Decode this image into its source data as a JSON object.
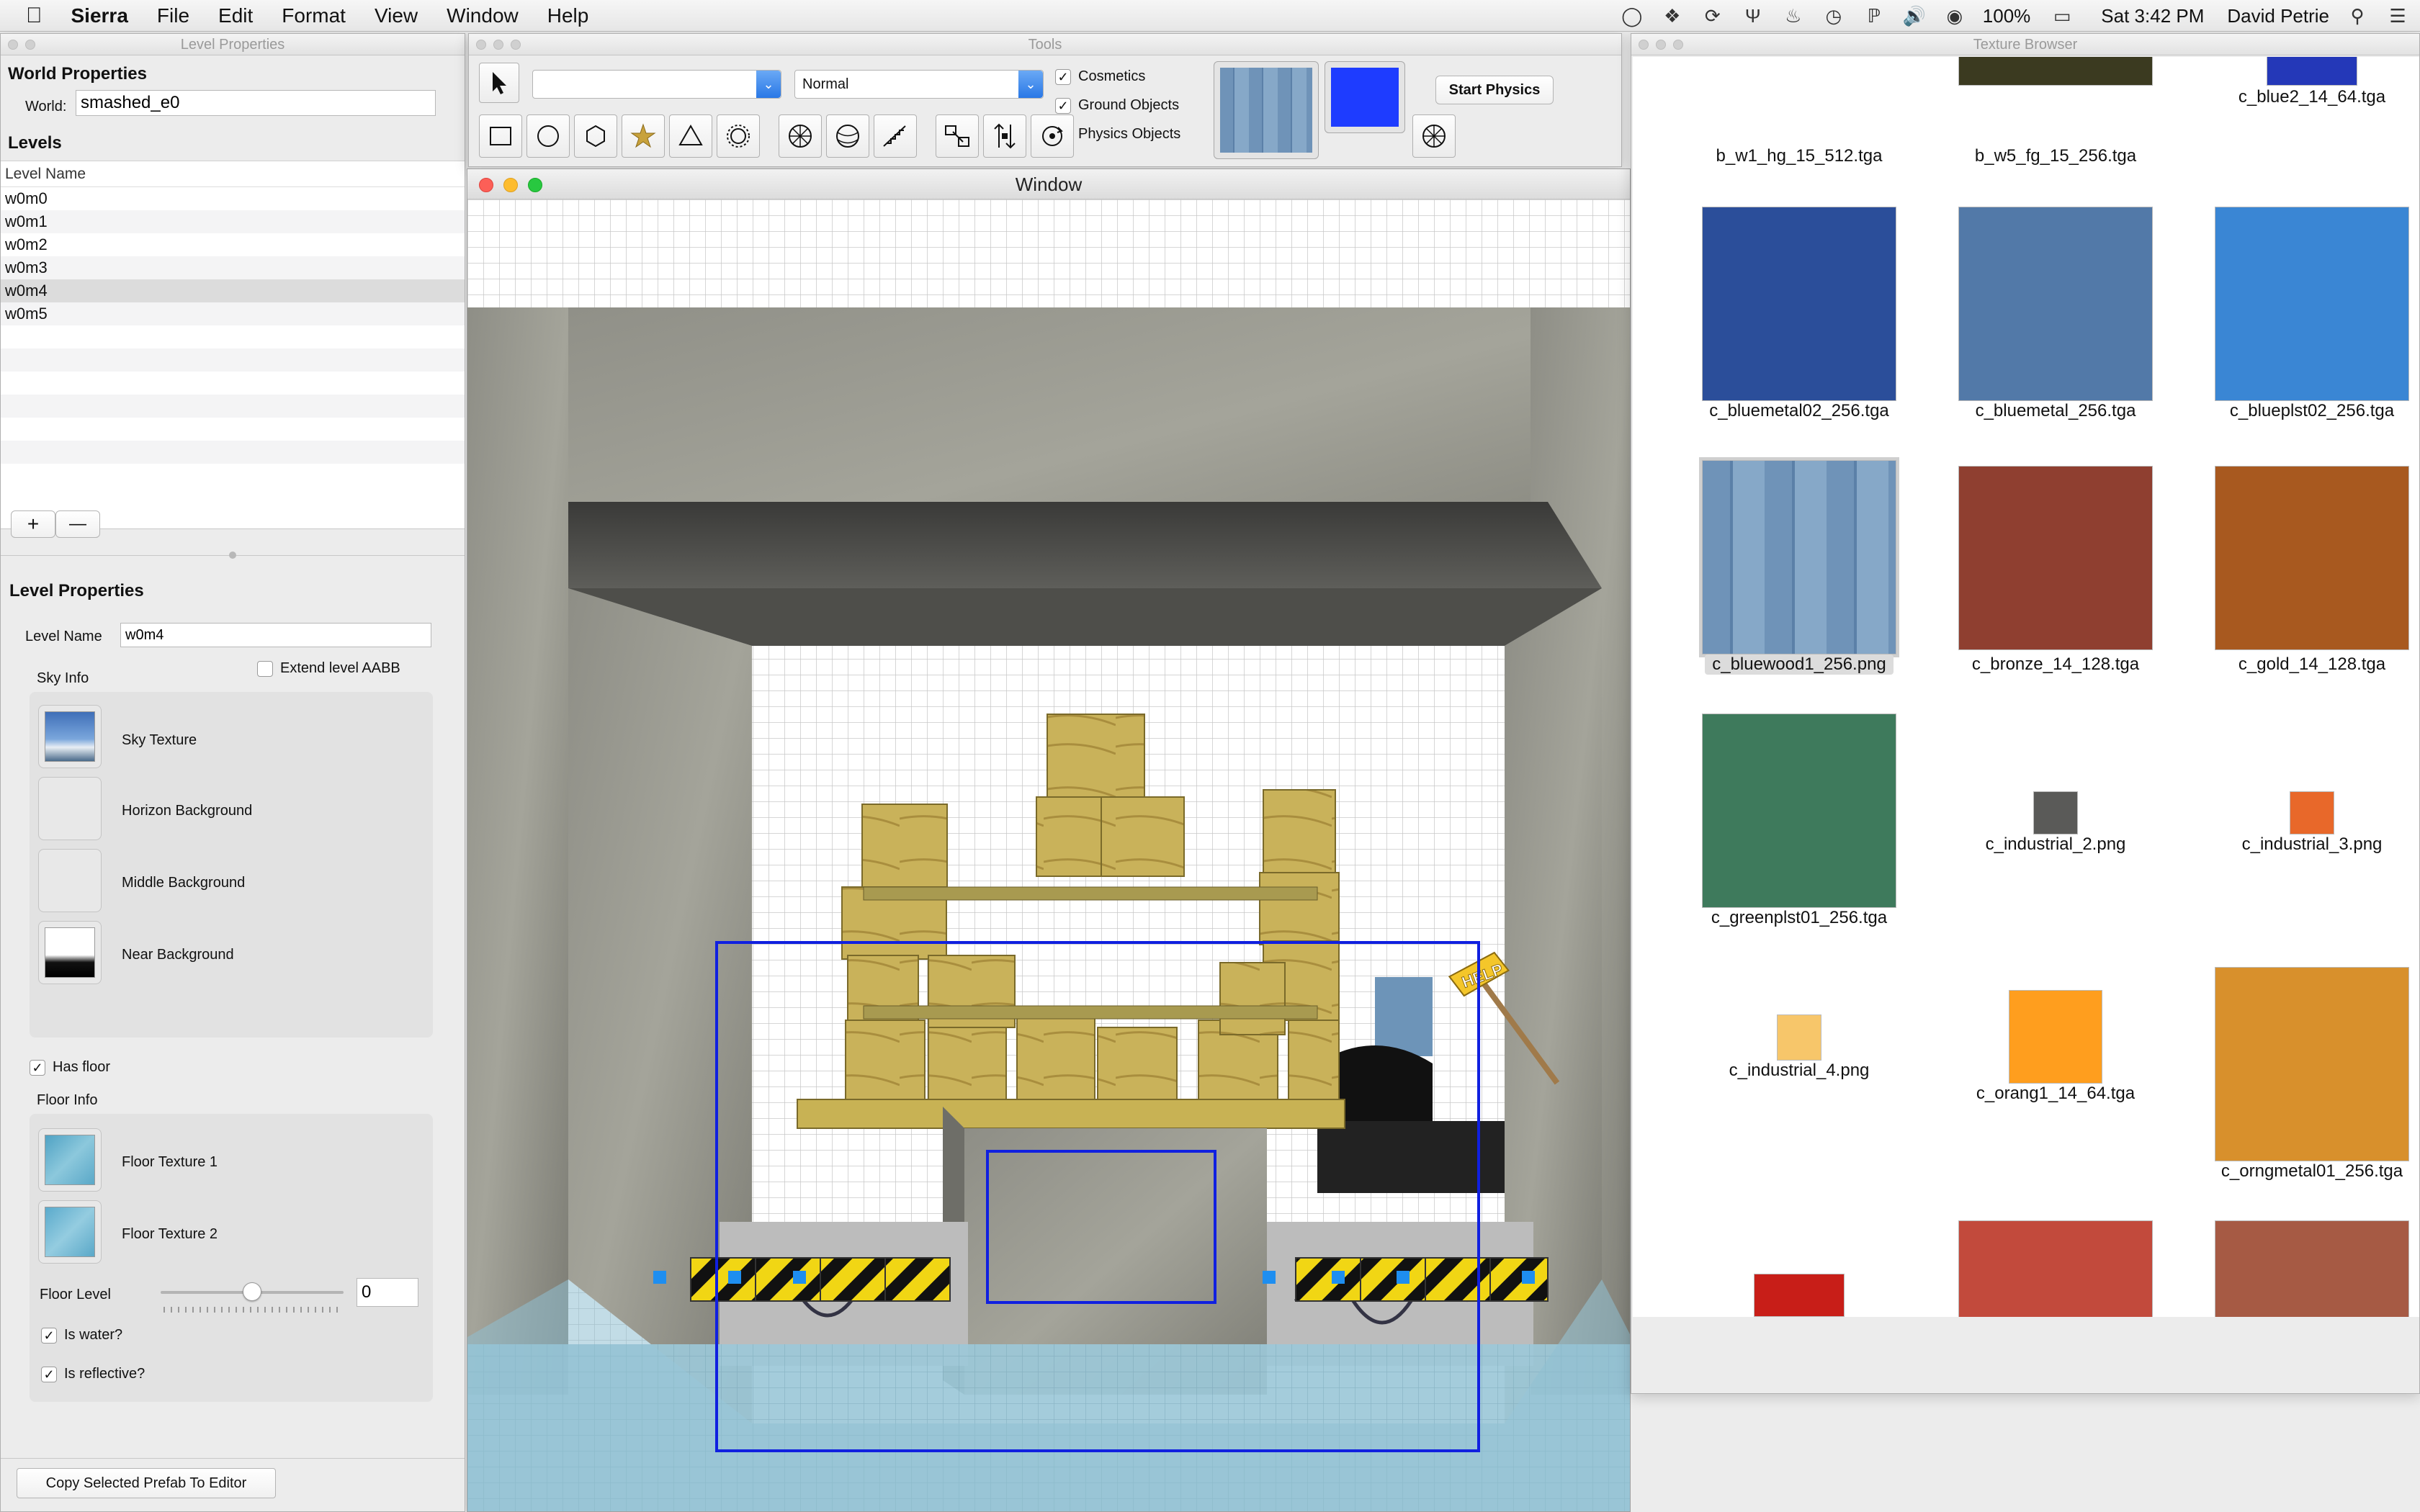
{
  "menubar": {
    "apple": "",
    "app": "Sierra",
    "items": [
      "File",
      "Edit",
      "Format",
      "View",
      "Window",
      "Help"
    ],
    "battery": "100%",
    "clock": "Sat 3:42 PM",
    "user": "David Petrie"
  },
  "level_panel": {
    "title": "Level Properties",
    "world_heading": "World Properties",
    "world_label": "World:",
    "world_value": "smashed_e0",
    "levels_heading": "Levels",
    "column_header": "Level Name",
    "levels": [
      "w0m0",
      "w0m1",
      "w0m2",
      "w0m3",
      "w0m4",
      "w0m5"
    ],
    "selected_level": "w0m4",
    "add_label": "+",
    "remove_label": "—",
    "props_heading": "Level Properties",
    "level_name_label": "Level Name",
    "level_name_value": "w0m4",
    "extend_aabb_label": "Extend level AABB",
    "extend_aabb_checked": false,
    "sky_info_label": "Sky Info",
    "sky_texture_label": "Sky Texture",
    "horizon_label": "Horizon Background",
    "middle_label": "Middle Background",
    "near_label": "Near Background",
    "has_floor_label": "Has floor",
    "has_floor_checked": true,
    "floor_info_label": "Floor Info",
    "floor_tex1_label": "Floor Texture 1",
    "floor_tex2_label": "Floor Texture 2",
    "floor_level_label": "Floor Level",
    "floor_level_value": "0",
    "floor_level_slider": 0.5,
    "is_water_label": "Is water?",
    "is_water_checked": true,
    "is_reflective_label": "Is reflective?",
    "is_reflective_checked": true,
    "copy_button": "Copy Selected Prefab To Editor"
  },
  "tools_panel": {
    "title": "Tools",
    "blend_value": "Normal",
    "cosmetics_label": "Cosmetics",
    "ground_objects_label": "Ground Objects",
    "physics_objects_label": "Physics Objects",
    "start_physics_label": "Start Physics",
    "color_swatch": "#1e3cff"
  },
  "viewport": {
    "title": "Window",
    "help_sign": "HELP"
  },
  "texture_browser": {
    "title": "Texture Browser",
    "textures": [
      {
        "name": "b_w1_hg_15_512.tga",
        "color": "#f7f7f7"
      },
      {
        "name": "b_w5_fg_15_256.tga",
        "color": "#3b3a20"
      },
      {
        "name": "c_blue2_14_64.tga",
        "color": "#2438b8"
      },
      {
        "name": "c_bluemetal02_256.tga",
        "color": "#2b4e9a"
      },
      {
        "name": "c_bluemetal_256.tga",
        "color": "#5279a8"
      },
      {
        "name": "c_blueplst02_256.tga",
        "color": "#3a86d4"
      },
      {
        "name": "c_bluewood1_256.png",
        "color": "#6f93b8"
      },
      {
        "name": "c_bronze_14_128.tga",
        "color": "#8f3f30"
      },
      {
        "name": "c_gold_14_128.tga",
        "color": "#a8591f"
      },
      {
        "name": "c_greenplst01_256.tga",
        "color": "#3e7a5c"
      },
      {
        "name": "c_industrial_2.png",
        "color": "#5a5a58"
      },
      {
        "name": "c_industrial_3.png",
        "color": "#e8682a"
      },
      {
        "name": "c_industrial_4.png",
        "color": "#f7c66a"
      },
      {
        "name": "c_orang1_14_64.tga",
        "color": "#ff9e1e"
      },
      {
        "name": "c_orngmetal01_256.tga",
        "color": "#d8902c"
      },
      {
        "name": "",
        "color": "#c81e18"
      },
      {
        "name": "",
        "color": "#c24a3c"
      },
      {
        "name": "",
        "color": "#a65a44"
      }
    ],
    "selected": "c_bluewood1_256.png"
  }
}
